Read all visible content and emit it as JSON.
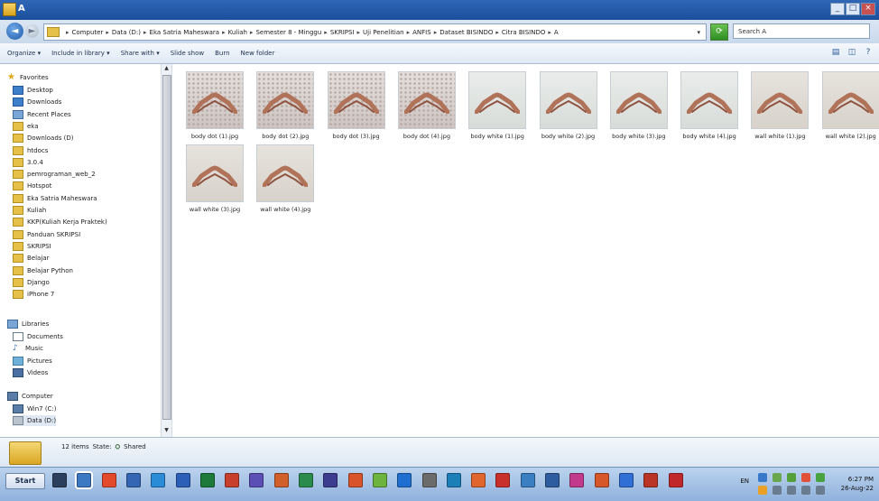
{
  "window": {
    "title": "A"
  },
  "address": {
    "crumbs": [
      "Computer",
      "Data (D:)",
      "Eka Satria Maheswara",
      "Kuliah",
      "Semester 8 - Minggu",
      "SKRIPSI",
      "Uji Penelitian",
      "ANFIS",
      "Dataset BISINDO",
      "Citra BISINDO",
      "A"
    ],
    "search_placeholder": "Search A"
  },
  "toolbar": {
    "organize": "Organize ▾",
    "include": "Include in library ▾",
    "share": "Share with ▾",
    "slideshow": "Slide show",
    "burn": "Burn",
    "new_folder": "New folder"
  },
  "sidebar": {
    "favorites": "Favorites",
    "fav_items": [
      "Desktop",
      "Downloads",
      "Recent Places",
      "eka",
      "Downloads (D)",
      "htdocs",
      "3.0.4",
      "pemrograman_web_2",
      "Hotspot",
      "Eka Satria Maheswara",
      "Kuliah",
      "KKP(Kuliah Kerja Praktek)",
      "Panduan SKRIPSI",
      "SKRIPSI",
      "Belajar",
      "Belajar Python",
      "Django",
      "iPhone 7"
    ],
    "libraries": "Libraries",
    "lib_items": [
      "Documents",
      "Music",
      "Pictures",
      "Videos"
    ],
    "computer": "Computer",
    "comp_items": [
      "Win7 (C:)",
      "Data (D:)"
    ]
  },
  "files": [
    {
      "name": "body dot (1).jpg",
      "bg": "dot"
    },
    {
      "name": "body dot (2).jpg",
      "bg": "dot"
    },
    {
      "name": "body dot (3).jpg",
      "bg": "dot"
    },
    {
      "name": "body dot (4).jpg",
      "bg": "dot"
    },
    {
      "name": "body white (1).jpg",
      "bg": "white"
    },
    {
      "name": "body white (2).jpg",
      "bg": "white"
    },
    {
      "name": "body white (3).jpg",
      "bg": "white"
    },
    {
      "name": "body white (4).jpg",
      "bg": "white"
    },
    {
      "name": "wall white (1).jpg",
      "bg": "wall"
    },
    {
      "name": "wall white (2).jpg",
      "bg": "wall"
    },
    {
      "name": "wall white (3).jpg",
      "bg": "wall"
    },
    {
      "name": "wall white (4).jpg",
      "bg": "wall"
    }
  ],
  "details": {
    "count": "12 items",
    "state_label": "State:",
    "state_value": "Shared"
  },
  "taskbar": {
    "start": "Start",
    "lang": "EN",
    "time": "6:27 PM",
    "date": "26-Aug-22",
    "icon_colors": [
      "#2c3f5c",
      "#3d79c2",
      "#e24a2b",
      "#3466b4",
      "#2a8bd6",
      "#2b5fb8",
      "#1d7a3a",
      "#c8402c",
      "#5b4fb5",
      "#d05f2a",
      "#2b8b4c",
      "#3d3d8f",
      "#d9542b",
      "#6db33f",
      "#1f6fd1",
      "#6b6b6b",
      "#1d7fb8",
      "#e0662e",
      "#c9302c",
      "#3a7fc1",
      "#2d5d9e",
      "#c23a8c",
      "#d7572b",
      "#2f6fd6",
      "#bb3526",
      "#c0282c"
    ],
    "tray_colors": [
      "#3778c9",
      "#6aa84f",
      "#56a03c",
      "#e3503a",
      "#49a340",
      "#e8a026",
      "#6b7c91",
      "#6b7c91",
      "#6b7c91",
      "#6b7c91"
    ]
  }
}
